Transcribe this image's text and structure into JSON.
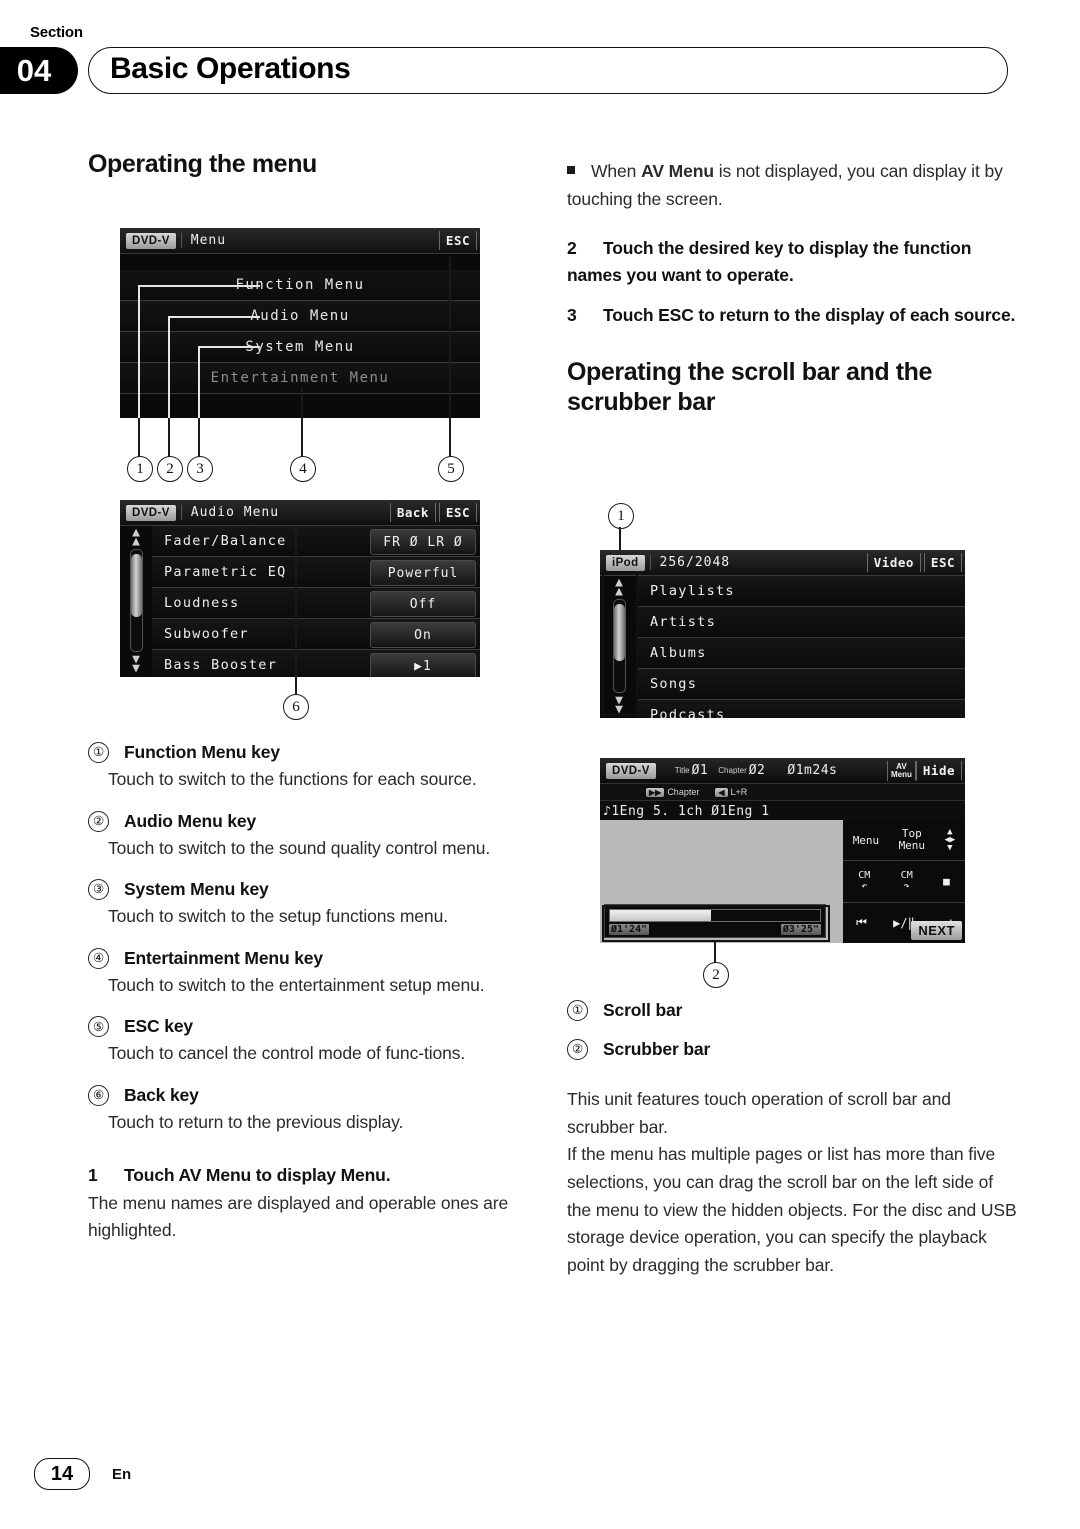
{
  "header": {
    "section_word": "Section",
    "section_number": "04",
    "title": "Basic Operations"
  },
  "left_column": {
    "heading": "Operating the menu",
    "key_definitions": [
      {
        "num": "①",
        "title": "Function Menu key",
        "body": "Touch to switch to the functions for each source."
      },
      {
        "num": "②",
        "title": "Audio Menu key",
        "body": "Touch to switch to the sound quality control menu."
      },
      {
        "num": "③",
        "title": "System Menu key",
        "body": "Touch to switch to the setup functions menu."
      },
      {
        "num": "④",
        "title": "Entertainment Menu key",
        "body": "Touch to switch to the entertainment setup menu."
      },
      {
        "num": "⑤",
        "title": "ESC key",
        "body": "Touch to cancel the control mode of func-tions."
      },
      {
        "num": "⑥",
        "title": "Back key",
        "body": "Touch to return to the previous display."
      }
    ],
    "step1_num": "1",
    "step1_text": "Touch AV Menu to display Menu.",
    "step1_body": "The menu names are displayed and operable ones are highlighted."
  },
  "right_column": {
    "note_bullet_pre": "When ",
    "note_bullet_bold": "AV Menu",
    "note_bullet_post": " is not displayed, you can display it by touching the screen.",
    "step2_num": "2",
    "step2_text": "Touch the desired key to display the function names you want to operate.",
    "step3_num": "3",
    "step3_text": "Touch ESC to return to the display of each source.",
    "heading": "Operating the scroll bar and the scrubber bar",
    "key_definitions": [
      {
        "num": "①",
        "title": "Scroll bar"
      },
      {
        "num": "②",
        "title": "Scrubber bar"
      }
    ],
    "para1": "This unit features touch operation of scroll bar and scrubber bar.",
    "para2": "If the menu has multiple pages or list has more than five selections, you can drag the scroll bar on the left side of the menu to view the hidden objects. For the disc and USB storage device operation, you can specify the playback point by dragging the scrubber bar."
  },
  "figure_menu": {
    "source_tag": "DVD-V",
    "title": "Menu",
    "esc_label": "ESC",
    "rows": [
      "Function Menu",
      "Audio Menu",
      "System Menu",
      "Entertainment Menu"
    ],
    "callouts": [
      "1",
      "2",
      "3",
      "4",
      "5"
    ]
  },
  "figure_audio_menu": {
    "source_tag": "DVD-V",
    "title": "Audio Menu",
    "back_label": "Back",
    "esc_label": "ESC",
    "rows": [
      {
        "label": "Fader/Balance",
        "value": "FR Ø LR Ø"
      },
      {
        "label": "Parametric EQ",
        "value": "Powerful"
      },
      {
        "label": "Loudness",
        "value": "Off"
      },
      {
        "label": "Subwoofer",
        "value": "On"
      },
      {
        "label": "Bass Booster",
        "value": "▶1"
      }
    ],
    "callout": "6"
  },
  "figure_ipod": {
    "source_tag": "iPod",
    "title": "256/2048",
    "video_label": "Video",
    "esc_label": "ESC",
    "rows": [
      "Playlists",
      "Artists",
      "Albums",
      "Songs",
      "Podcasts"
    ],
    "callout": "1"
  },
  "figure_dvd": {
    "source_tag": "DVD-V",
    "title_label": "Title",
    "title_value": "Ø1",
    "chapter_label": "Chapter",
    "chapter_value": "Ø2",
    "elapsed": "Ø1m24s",
    "avmenu_label_1": "AV",
    "avmenu_label_2": "Menu",
    "hide_label": "Hide",
    "sub_chapter": "Chapter",
    "sub_audio": "L+R",
    "info_line": "♪1Eng  5. 1ch  Ø1Eng  1",
    "pad": {
      "menu": "Menu",
      "top_menu_1": "Top",
      "top_menu_2": "Menu",
      "cm_back_1": "CM",
      "cm_fwd_1": "CM",
      "stop": "■",
      "prev": "⏮",
      "playpause": "▶/‖",
      "next": "⏭",
      "next_btn": "NEXT"
    },
    "time_current": "Ø1'24\"",
    "time_total": "Ø3'25\"",
    "callout": "2"
  },
  "footer": {
    "page": "14",
    "lang": "En"
  }
}
